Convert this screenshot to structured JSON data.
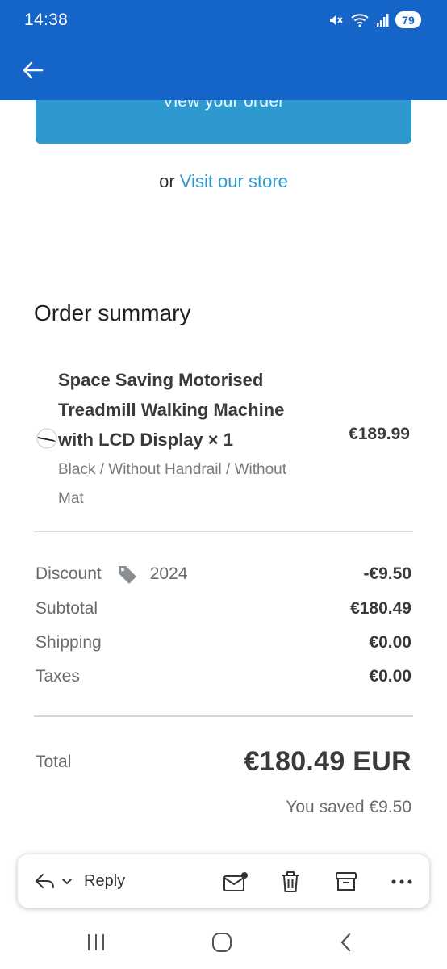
{
  "status_bar": {
    "time": "14:38",
    "battery": "79",
    "icons": [
      "mute-icon",
      "wifi-icon",
      "signal-icon",
      "battery-icon"
    ]
  },
  "app_bar": {
    "back_icon": "arrow-left-icon"
  },
  "colors": {
    "app_bar": "#1565c8",
    "button": "#2e99cf",
    "link": "#2e99cf"
  },
  "email": {
    "view_order_label": "View your order",
    "store_prefix": "or",
    "store_link": "Visit our store",
    "summary_title": "Order summary",
    "product": {
      "name": "Space Saving Motorised Treadmill Walking Machine with LCD Display × 1",
      "price": "€189.99",
      "variant": "Black / Without Handrail / Without Mat"
    },
    "discount": {
      "label": "Discount",
      "code": "2024",
      "value": "-€9.50"
    },
    "subtotal": {
      "label": "Subtotal",
      "value": "€180.49"
    },
    "shipping": {
      "label": "Shipping",
      "value": "€0.00"
    },
    "taxes": {
      "label": "Taxes",
      "value": "€0.00"
    },
    "total": {
      "label": "Total",
      "value": "€180.49 EUR"
    },
    "saved": "You saved €9.50"
  },
  "action_bar": {
    "reply_label": "Reply",
    "icons": [
      "reply-icon",
      "chevron-down-icon",
      "mark-unread-icon",
      "delete-icon",
      "archive-icon",
      "more-icon"
    ]
  },
  "nav_bar": {
    "icons": [
      "recents-icon",
      "home-icon",
      "back-icon"
    ]
  }
}
